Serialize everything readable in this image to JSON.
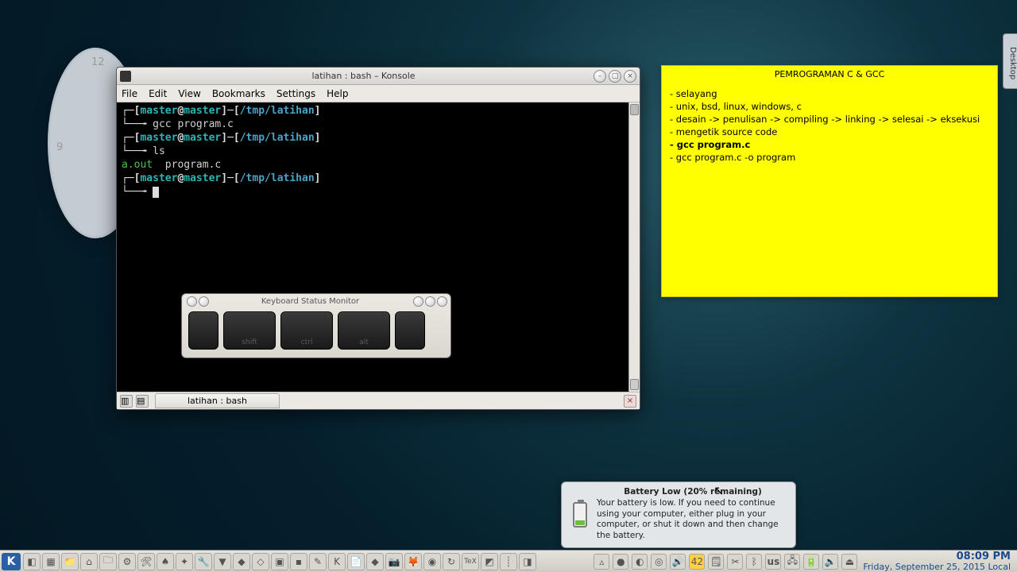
{
  "clock": {
    "num9": "9",
    "num12": "12"
  },
  "sticky": {
    "title": "PEMROGRAMAN C & GCC",
    "lines": [
      {
        "text": "- selayang",
        "bold": false
      },
      {
        "text": "- unix, bsd, linux, windows, c",
        "bold": false
      },
      {
        "text": "- desain -> penulisan -> compiling -> linking -> selesai -> eksekusi",
        "bold": false
      },
      {
        "text": "- mengetik source code",
        "bold": false
      },
      {
        "text": "- gcc program.c",
        "bold": true
      },
      {
        "text": "- gcc program.c -o program",
        "bold": false
      }
    ]
  },
  "edge_tab": "Desktop",
  "konsole": {
    "title": "latihan : bash – Konsole",
    "menu": {
      "file": "File",
      "edit": "Edit",
      "view": "View",
      "bookmarks": "Bookmarks",
      "settings": "Settings",
      "help": "Help"
    },
    "tab_label": "latihan : bash",
    "prompt": {
      "user": "master",
      "host": "master",
      "path": "/tmp/latihan"
    },
    "lines": {
      "cmd1": "gcc program.c",
      "cmd2": "ls",
      "out_exec": "a.out",
      "out_file": "program.c"
    }
  },
  "ksm": {
    "title": "Keyboard Status Monitor",
    "keys": {
      "shift": "shift",
      "ctrl": "ctrl",
      "alt": "alt"
    }
  },
  "battery": {
    "title": "Battery Low (20% remaining)",
    "body": "Your battery is low. If you need to continue using your computer, either plug in your computer, or shut it down and then change the battery."
  },
  "taskbar": {
    "kmenu": "K",
    "tray": {
      "temp": "42",
      "layout": "us"
    },
    "time": "08:09 PM",
    "date": "Friday, September 25, 2015 Local"
  }
}
